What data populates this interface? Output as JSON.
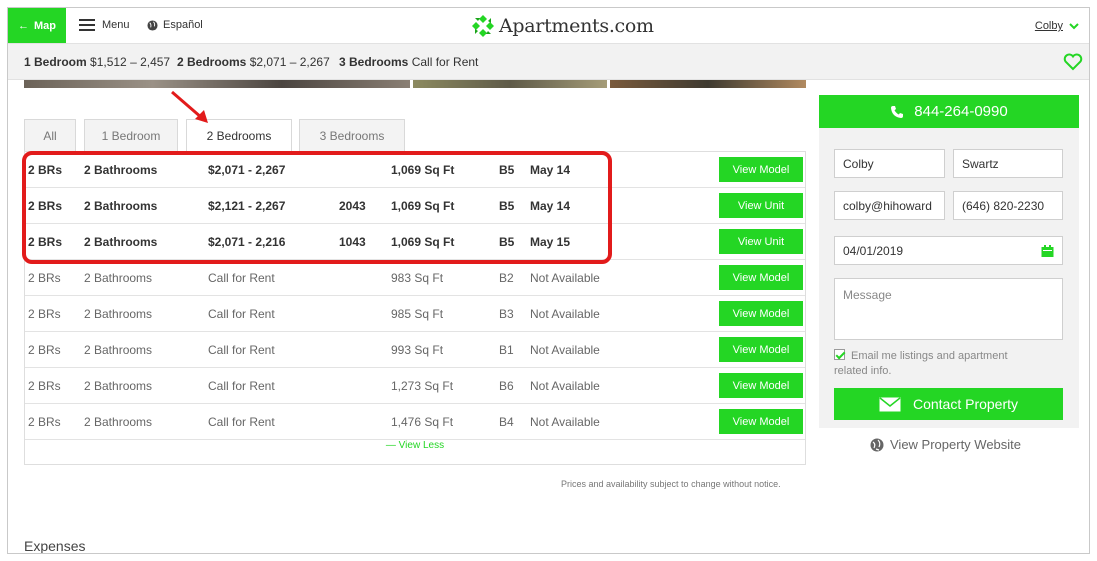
{
  "header": {
    "map_label": "Map",
    "menu_label": "Menu",
    "language_label": "Español",
    "logo_text": "Apartments.com",
    "user_name": "Colby",
    "brand_color": "#24d624"
  },
  "summary": [
    {
      "type": "1 Bedroom",
      "price": "$1,512 – 2,457"
    },
    {
      "type": "2 Bedrooms",
      "price": "$2,071 – 2,267"
    },
    {
      "type": "3 Bedrooms",
      "price": "Call for Rent"
    }
  ],
  "tabs": [
    "All",
    "1 Bedroom",
    "2 Bedrooms",
    "3 Bedrooms"
  ],
  "active_tab": "2 Bedrooms",
  "units": [
    {
      "beds": "2 BRs",
      "baths": "2 Bathrooms",
      "price": "$2,071 - 2,267",
      "unit": "",
      "sqft": "1,069 Sq Ft",
      "model": "B5",
      "avail": "May 14",
      "action": "View Model"
    },
    {
      "beds": "2 BRs",
      "baths": "2 Bathrooms",
      "price": "$2,121 - 2,267",
      "unit": "2043",
      "sqft": "1,069 Sq Ft",
      "model": "B5",
      "avail": "May 14",
      "action": "View Unit"
    },
    {
      "beds": "2 BRs",
      "baths": "2 Bathrooms",
      "price": "$2,071 - 2,216",
      "unit": "1043",
      "sqft": "1,069 Sq Ft",
      "model": "B5",
      "avail": "May 15",
      "action": "View Unit"
    },
    {
      "beds": "2 BRs",
      "baths": "2 Bathrooms",
      "price": "Call for Rent",
      "unit": "",
      "sqft": "983 Sq Ft",
      "model": "B2",
      "avail": "Not Available",
      "action": "View Model"
    },
    {
      "beds": "2 BRs",
      "baths": "2 Bathrooms",
      "price": "Call for Rent",
      "unit": "",
      "sqft": "985 Sq Ft",
      "model": "B3",
      "avail": "Not Available",
      "action": "View Model"
    },
    {
      "beds": "2 BRs",
      "baths": "2 Bathrooms",
      "price": "Call for Rent",
      "unit": "",
      "sqft": "993 Sq Ft",
      "model": "B1",
      "avail": "Not Available",
      "action": "View Model"
    },
    {
      "beds": "2 BRs",
      "baths": "2 Bathrooms",
      "price": "Call for Rent",
      "unit": "",
      "sqft": "1,273 Sq Ft",
      "model": "B6",
      "avail": "Not Available",
      "action": "View Model"
    },
    {
      "beds": "2 BRs",
      "baths": "2 Bathrooms",
      "price": "Call for Rent",
      "unit": "",
      "sqft": "1,476 Sq Ft",
      "model": "B4",
      "avail": "Not Available",
      "action": "View Model"
    }
  ],
  "view_less": "— View Less",
  "disclaimer": "Prices and availability subject to change without notice.",
  "expenses_heading": "Expenses",
  "contact_form": {
    "phone": "844-264-0990",
    "first_name": "Colby",
    "last_name": "Swartz",
    "email": "colby@hihoward",
    "phone_value": "(646) 820-2230",
    "move_in_date": "04/01/2019",
    "message_placeholder": "Message",
    "optin_label": "Email me listings and apartment related info.",
    "optin_checked": true,
    "submit_label": "Contact Property",
    "website_link": "View Property Website"
  }
}
